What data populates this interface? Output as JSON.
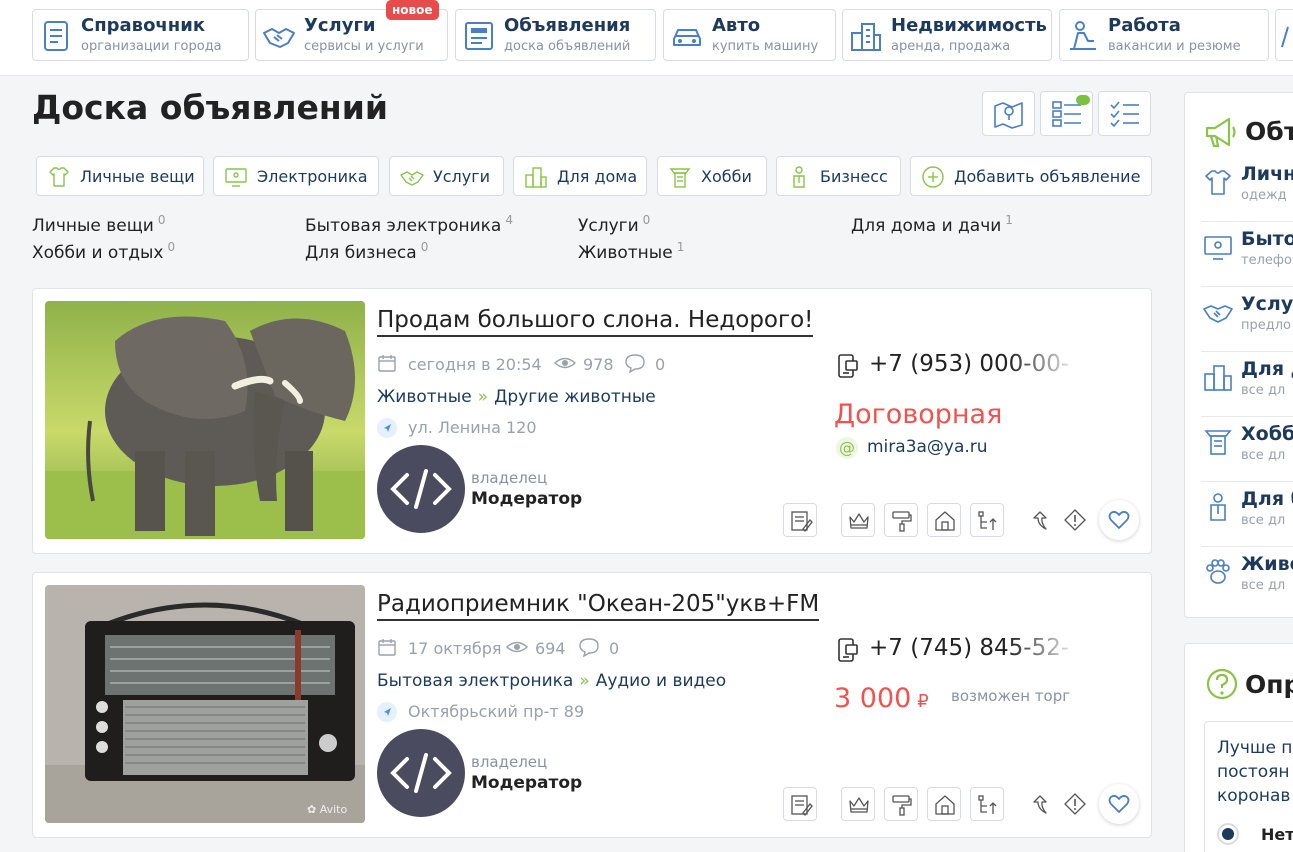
{
  "nav": [
    {
      "title": "Справочник",
      "subtitle": "организации города",
      "icon": "directory-icon"
    },
    {
      "title": "Услуги",
      "subtitle": "сервисы и услуги",
      "icon": "handshake-icon",
      "badge": "новое"
    },
    {
      "title": "Объявления",
      "subtitle": "доска объявлений",
      "icon": "board-icon"
    },
    {
      "title": "Авто",
      "subtitle": "купить машину",
      "icon": "car-icon"
    },
    {
      "title": "Недвижимость",
      "subtitle": "аренда, продажа",
      "icon": "buildings-icon"
    },
    {
      "title": "Работа",
      "subtitle": "вакансии и резюме",
      "icon": "worker-icon"
    }
  ],
  "page_title": "Доска объявлений",
  "view_icons": [
    "map-view-icon",
    "list-view-icon",
    "checklist-view-icon"
  ],
  "categories": [
    {
      "label": "Личные вещи",
      "icon": "tshirt-icon"
    },
    {
      "label": "Электроника",
      "icon": "monitor-icon"
    },
    {
      "label": "Услуги",
      "icon": "handshake-icon"
    },
    {
      "label": "Для дома",
      "icon": "house-icon"
    },
    {
      "label": "Хобби",
      "icon": "hobby-icon"
    },
    {
      "label": "Бизнесс",
      "icon": "business-icon"
    },
    {
      "label": "Добавить объявление",
      "icon": "plus-circle-icon"
    }
  ],
  "category_links": [
    {
      "label": "Личные вещи",
      "count": "0"
    },
    {
      "label": "Бытовая электроника",
      "count": "4"
    },
    {
      "label": "Услуги",
      "count": "0"
    },
    {
      "label": "Для дома и дачи",
      "count": "1"
    },
    {
      "label": "Хобби и отдых",
      "count": "0"
    },
    {
      "label": "Для бизнеса",
      "count": "0"
    },
    {
      "label": "Животные",
      "count": "1"
    }
  ],
  "listings": [
    {
      "title": "Продам большого слона. Недорого!",
      "date": "сегодня в 20:54",
      "views": "978",
      "comments": "0",
      "category": "Животные",
      "subcategory": "Другие животные",
      "address": "ул. Ленина 120",
      "owner_role": "владелец",
      "owner_name": "Модератор",
      "phone": "+7 (953) 000-00-",
      "price": "Договорная",
      "price_unit": "",
      "bargain": "",
      "email": "mira3a@ya.ru"
    },
    {
      "title": "Радиоприемник \"Океан-205\"укв+FM",
      "date": "17 октября",
      "views": "694",
      "comments": "0",
      "category": "Бытовая электроника",
      "subcategory": "Аудио и видео",
      "address": "Октябрьский пр-т 89",
      "owner_role": "владелец",
      "owner_name": "Модератор",
      "phone": "+7 (745) 845-52-",
      "price": "3 000",
      "price_unit": "₽",
      "bargain": "возможен торг",
      "email": ""
    }
  ],
  "sidebar": {
    "heading": "Объ",
    "items": [
      {
        "name": "Личн",
        "desc": "одежд",
        "icon": "tshirt-icon"
      },
      {
        "name": "Быто",
        "desc": "телефо",
        "icon": "monitor-icon"
      },
      {
        "name": "Услу",
        "desc": "предло",
        "icon": "handshake-icon"
      },
      {
        "name": "Для д",
        "desc": "все дл",
        "icon": "buildings-icon"
      },
      {
        "name": "Хобб",
        "desc": "все дл",
        "icon": "hobby-icon"
      },
      {
        "name": "Для б",
        "desc": "все дл",
        "icon": "business-icon"
      },
      {
        "name": "Живо",
        "desc": "все дл",
        "icon": "paw-icon"
      }
    ],
    "poll_heading": "Опр",
    "poll_question": [
      "Лучше п",
      "постоян",
      "коронав"
    ],
    "poll_option": "Нет"
  },
  "colors": {
    "primary": "#1d3a5c",
    "accent_green": "#8bc34a",
    "price_red": "#ef5350",
    "badge_red": "#e94a4a",
    "icon_blue": "#4a7fc1"
  }
}
